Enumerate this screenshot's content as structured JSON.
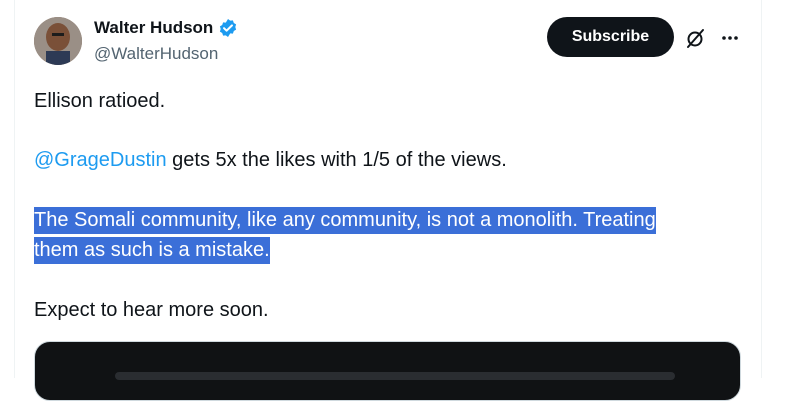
{
  "author": {
    "name": "Walter Hudson",
    "handle": "@WalterHudson"
  },
  "actions": {
    "subscribe_label": "Subscribe"
  },
  "tweet": {
    "line1": "Ellison ratioed.",
    "mention": "@GrageDustin",
    "line2_rest": " gets 5x the likes with 1/5 of the views.",
    "line3a": "The Somali community, like any community, is not a monolith. Treating",
    "line3b": "them as such is a mistake.",
    "line4": "Expect to hear more soon."
  },
  "icons": {
    "verified": "verified-badge-icon",
    "grok": "grok-icon",
    "more": "more-icon"
  },
  "colors": {
    "accent": "#1d9bf0",
    "selection": "#3b6fd8",
    "button": "#0f1419"
  }
}
